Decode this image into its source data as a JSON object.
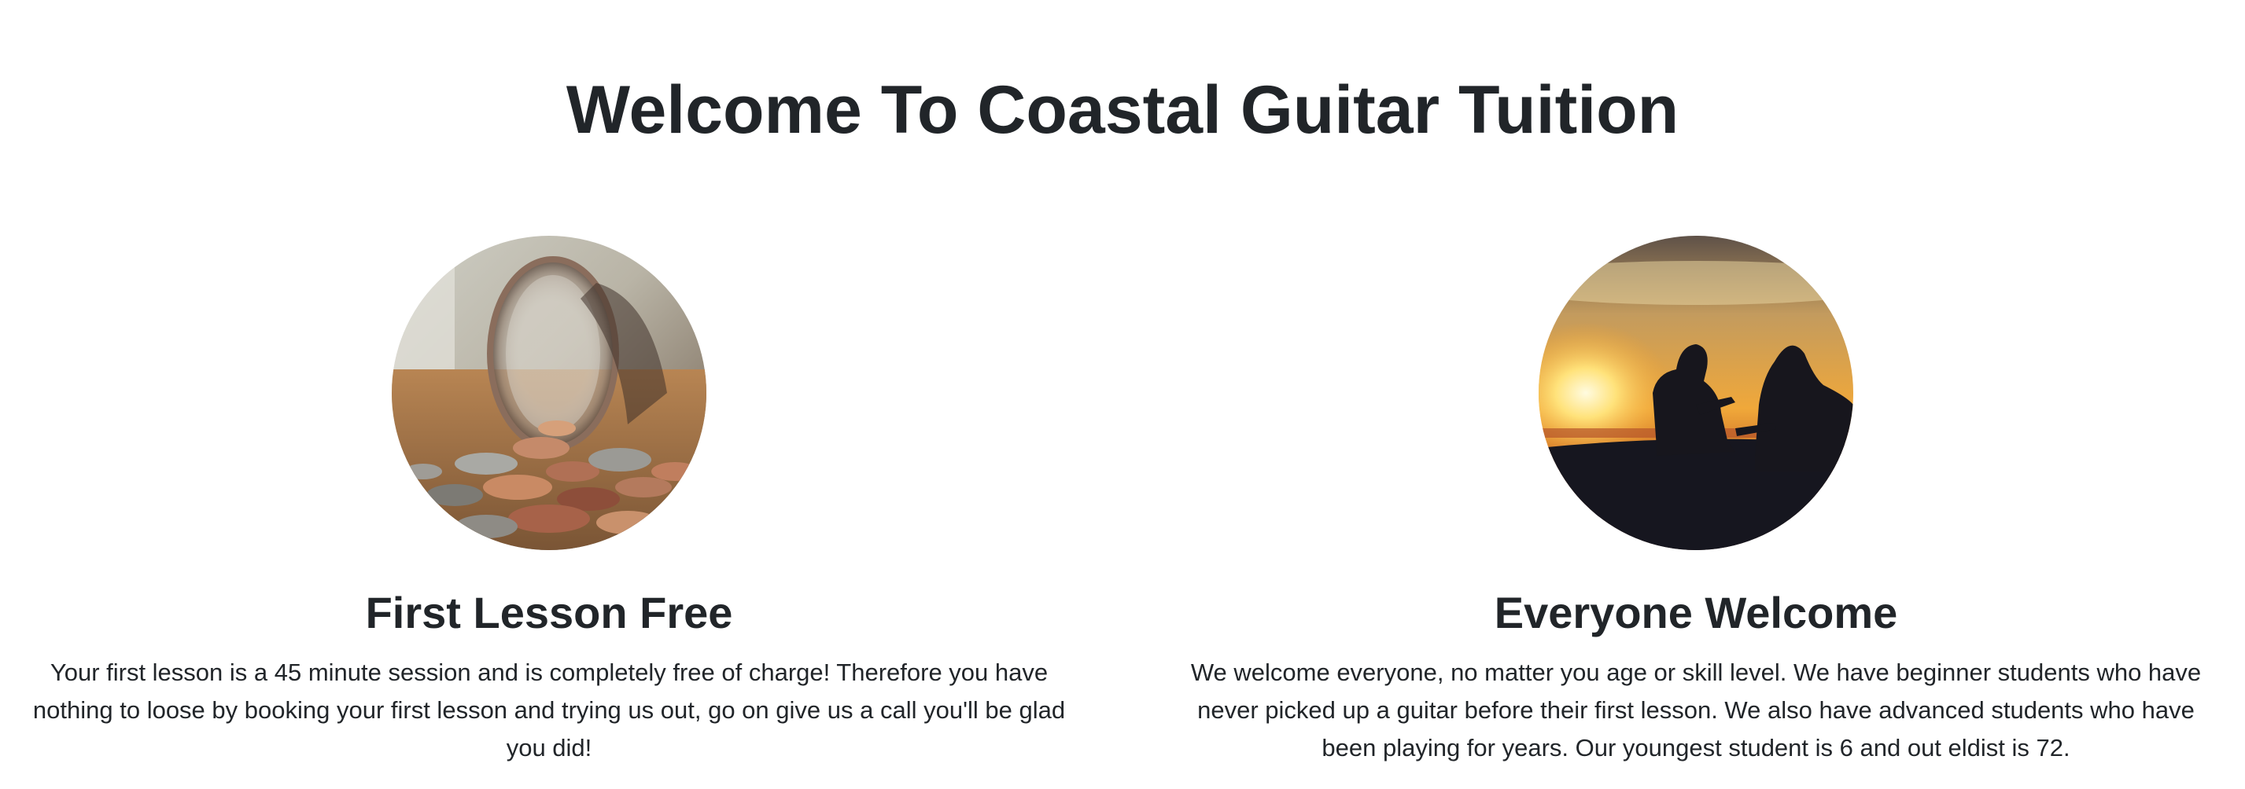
{
  "page": {
    "title": "Welcome To Coastal Guitar Tuition"
  },
  "features": [
    {
      "heading": "First Lesson Free",
      "text": "Your first lesson is a 45 minute session and is completely free of charge! Therefore you have nothing to loose by booking your first lesson and trying us out, go on give us a call you'll be glad you did!",
      "image": "coin-jar-photo"
    },
    {
      "heading": "Everyone Welcome",
      "text": "We welcome everyone, no matter you age or skill level. We have beginner students who have never picked up a guitar before their first lesson. We also have advanced students who have been playing for years. Our youngest student is 6 and out eldist is 72.",
      "image": "sunset-guitarists-photo"
    }
  ],
  "colors": {
    "text": "#212529",
    "background": "#ffffff"
  }
}
